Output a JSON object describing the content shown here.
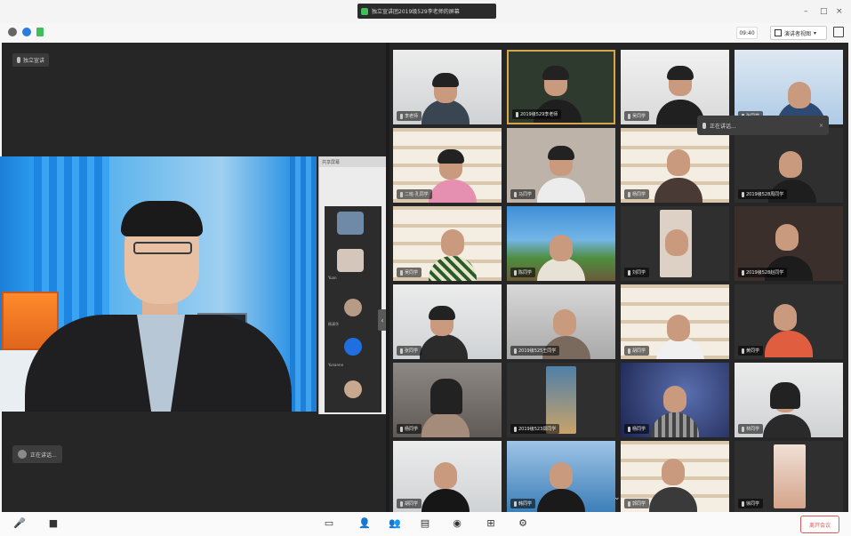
{
  "window": {
    "title": "独立宣讲团2019级529李老师的屏幕",
    "minimize": "–",
    "maximize": "□",
    "close": "×"
  },
  "toolbar": {
    "time": "09:40",
    "view_label": "演讲者视图"
  },
  "stage": {
    "left_tag": "独立宣讲",
    "speaker_tag": "正在讲话..."
  },
  "share_panel": {
    "header": "共享屏幕",
    "labels": [
      "Yuan",
      "杨清华",
      "Yunanne"
    ]
  },
  "popup": {
    "text": "正在讲话...",
    "close": "×"
  },
  "gallery": {
    "tiles": [
      {
        "label": "李老师"
      },
      {
        "label": "2019级529李老师"
      },
      {
        "label": "吴同学"
      },
      {
        "label": "张同学"
      },
      {
        "label": "二班·孔同学"
      },
      {
        "label": "马同学"
      },
      {
        "label": "杨同学"
      },
      {
        "label": "2019级528周同学"
      },
      {
        "label": "吴同学"
      },
      {
        "label": "陈同学"
      },
      {
        "label": "刘同学"
      },
      {
        "label": "2019级528赵同学"
      },
      {
        "label": "张同学"
      },
      {
        "label": "2019级525王同学"
      },
      {
        "label": "胡同学"
      },
      {
        "label": "黄同学"
      },
      {
        "label": "杨同学"
      },
      {
        "label": "2019级523郑同学"
      },
      {
        "label": "杨同学"
      },
      {
        "label": "林同学"
      },
      {
        "label": "胡同学"
      },
      {
        "label": "韩同学"
      },
      {
        "label": "郭同学"
      },
      {
        "label": "徐同学"
      }
    ],
    "more": "⌄"
  },
  "bottom": {
    "mute_label": "",
    "leave_label": "离开会议"
  },
  "colors": {
    "stage_bg": "#262626",
    "accent_green": "#3fbf5a",
    "leave_red": "#e05a5a"
  }
}
